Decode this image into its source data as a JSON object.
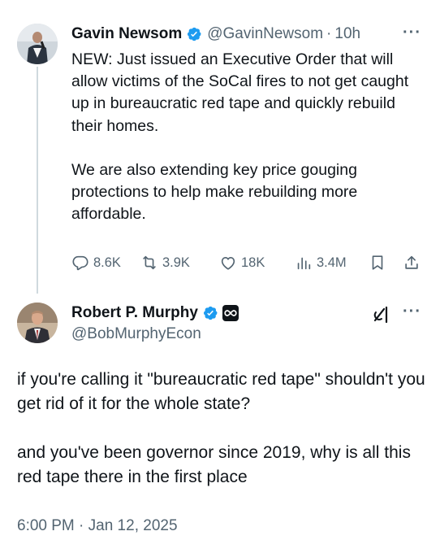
{
  "parent_tweet": {
    "display_name": "Gavin Newsom",
    "handle": "@GavinNewsom",
    "time": "10h",
    "more_label": "···",
    "paragraphs": [
      "NEW: Just issued an Executive Order that will allow victims of the SoCal fires to not get caught up in bureaucratic red tape and quickly rebuild their homes.",
      "We are also extending key price gouging protections to help make rebuilding more affordable."
    ],
    "actions": {
      "replies": "8.6K",
      "reposts": "3.9K",
      "likes": "18K",
      "views": "3.4M"
    },
    "icons": [
      "verified-badge-icon",
      "reply-icon",
      "repost-icon",
      "like-icon",
      "views-icon",
      "bookmark-icon",
      "share-icon",
      "more-icon"
    ]
  },
  "reply_tweet": {
    "display_name": "Robert P. Murphy",
    "handle": "@BobMurphyEcon",
    "more_label": "···",
    "paragraphs": [
      "if you're calling it \"bureaucratic red tape\" shouldn't you get rid of it for the whole state?",
      "and you've been governor since 2019, why is all this red tape there in the first place"
    ],
    "timestamp": "6:00 PM · Jan 12, 2025",
    "icons": [
      "verified-badge-icon",
      "subscription-badge-icon",
      "grok-icon",
      "more-icon"
    ]
  },
  "colors": {
    "verified_blue": "#1d9bf0",
    "secondary_text": "#536471",
    "primary_text": "#0f1419",
    "thread_line": "#cfd9de"
  }
}
